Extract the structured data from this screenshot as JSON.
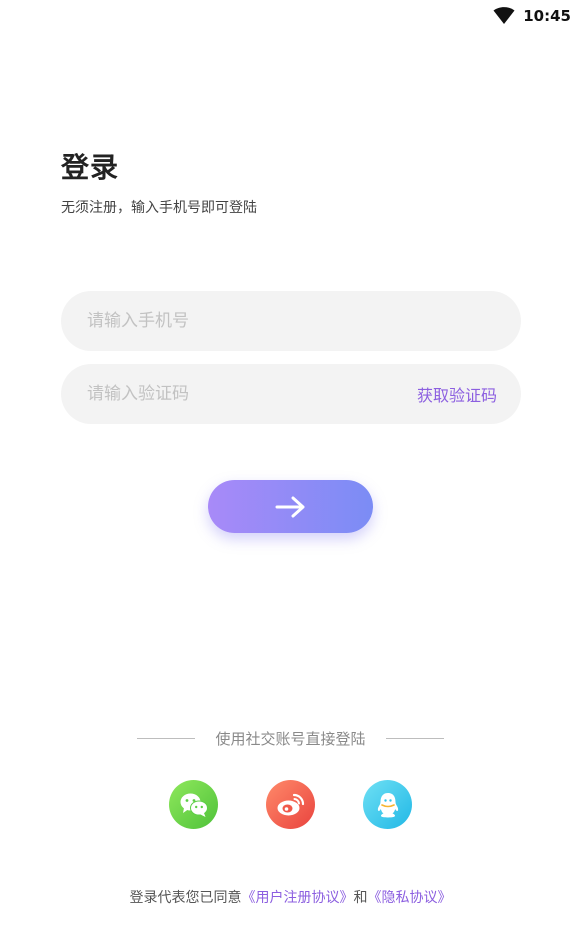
{
  "status_bar": {
    "time": "10:45",
    "wifi_icon": "wifi-icon"
  },
  "login": {
    "title": "登录",
    "subtitle": "无须注册，输入手机号即可登陆",
    "phone_placeholder": "请输入手机号",
    "code_placeholder": "请输入验证码",
    "get_code_label": "获取验证码",
    "submit_icon": "arrow-right-icon"
  },
  "social": {
    "label": "使用社交账号直接登陆",
    "items": [
      {
        "name": "wechat",
        "icon": "wechat-icon",
        "color": "#5ccf45"
      },
      {
        "name": "weibo",
        "icon": "weibo-icon",
        "color": "#f0584a"
      },
      {
        "name": "qq",
        "icon": "qq-icon",
        "color": "#2fc3eb"
      }
    ]
  },
  "agreement": {
    "prefix": "登录代表您已同意",
    "user_agreement": "《用户注册协议》",
    "conjunction": "和",
    "privacy_agreement": "《隐私协议》"
  },
  "colors": {
    "accent": "#8c5fe0",
    "field_background": "#f3f3f3",
    "button_gradient_start": "#a88af8",
    "button_gradient_end": "#7b8cf5"
  }
}
